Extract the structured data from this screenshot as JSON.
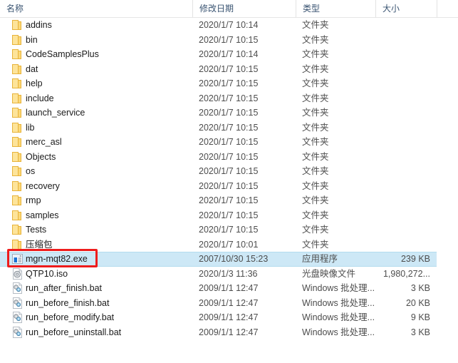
{
  "columns": [
    {
      "key": "name",
      "label": "名称"
    },
    {
      "key": "date",
      "label": "修改日期"
    },
    {
      "key": "type",
      "label": "类型"
    },
    {
      "key": "size",
      "label": "大小"
    }
  ],
  "header": {
    "name_label": "名称",
    "date_label": "修改日期",
    "type_label": "类型",
    "size_label": "大小"
  },
  "colors": {
    "selection_fill": "#cde8f6",
    "selection_border": "#b3dcee",
    "annotation": "#ee1c1c",
    "folder_icon": "#fde49a",
    "folder_icon_edge": "#e8b339",
    "header_text": "#3a5472",
    "row_text": "#1a1a1a",
    "meta_text": "#4d4d4d"
  },
  "annotation": {
    "shape": "rectangle",
    "target_row_index": 15,
    "target_label": "mgn-mqt82.exe"
  },
  "rows": [
    {
      "name": "addins",
      "date": "2020/1/7 10:14",
      "type": "文件夹",
      "size": "",
      "icon": "folder-icon",
      "selected": false
    },
    {
      "name": "bin",
      "date": "2020/1/7 10:15",
      "type": "文件夹",
      "size": "",
      "icon": "folder-icon",
      "selected": false
    },
    {
      "name": "CodeSamplesPlus",
      "date": "2020/1/7 10:14",
      "type": "文件夹",
      "size": "",
      "icon": "folder-icon",
      "selected": false
    },
    {
      "name": "dat",
      "date": "2020/1/7 10:15",
      "type": "文件夹",
      "size": "",
      "icon": "folder-icon",
      "selected": false
    },
    {
      "name": "help",
      "date": "2020/1/7 10:15",
      "type": "文件夹",
      "size": "",
      "icon": "folder-icon",
      "selected": false
    },
    {
      "name": "include",
      "date": "2020/1/7 10:15",
      "type": "文件夹",
      "size": "",
      "icon": "folder-icon",
      "selected": false
    },
    {
      "name": "launch_service",
      "date": "2020/1/7 10:15",
      "type": "文件夹",
      "size": "",
      "icon": "folder-icon",
      "selected": false
    },
    {
      "name": "lib",
      "date": "2020/1/7 10:15",
      "type": "文件夹",
      "size": "",
      "icon": "folder-icon",
      "selected": false
    },
    {
      "name": "merc_asl",
      "date": "2020/1/7 10:15",
      "type": "文件夹",
      "size": "",
      "icon": "folder-icon",
      "selected": false
    },
    {
      "name": "Objects",
      "date": "2020/1/7 10:15",
      "type": "文件夹",
      "size": "",
      "icon": "folder-icon",
      "selected": false
    },
    {
      "name": "os",
      "date": "2020/1/7 10:15",
      "type": "文件夹",
      "size": "",
      "icon": "folder-icon",
      "selected": false
    },
    {
      "name": "recovery",
      "date": "2020/1/7 10:15",
      "type": "文件夹",
      "size": "",
      "icon": "folder-icon",
      "selected": false
    },
    {
      "name": "rmp",
      "date": "2020/1/7 10:15",
      "type": "文件夹",
      "size": "",
      "icon": "folder-icon",
      "selected": false
    },
    {
      "name": "samples",
      "date": "2020/1/7 10:15",
      "type": "文件夹",
      "size": "",
      "icon": "folder-icon",
      "selected": false
    },
    {
      "name": "Tests",
      "date": "2020/1/7 10:15",
      "type": "文件夹",
      "size": "",
      "icon": "folder-icon",
      "selected": false
    },
    {
      "name": "压缩包",
      "date": "2020/1/7 10:01",
      "type": "文件夹",
      "size": "",
      "icon": "folder-icon",
      "selected": false
    },
    {
      "name": "mgn-mqt82.exe",
      "date": "2007/10/30 15:23",
      "type": "应用程序",
      "size": "239 KB",
      "icon": "application-icon",
      "selected": true
    },
    {
      "name": "QTP10.iso",
      "date": "2020/1/3 11:36",
      "type": "光盘映像文件",
      "size": "1,980,272...",
      "icon": "disc-image-icon",
      "selected": false
    },
    {
      "name": "run_after_finish.bat",
      "date": "2009/1/1 12:47",
      "type": "Windows 批处理...",
      "size": "3 KB",
      "icon": "batch-file-icon",
      "selected": false
    },
    {
      "name": "run_before_finish.bat",
      "date": "2009/1/1 12:47",
      "type": "Windows 批处理...",
      "size": "20 KB",
      "icon": "batch-file-icon",
      "selected": false
    },
    {
      "name": "run_before_modify.bat",
      "date": "2009/1/1 12:47",
      "type": "Windows 批处理...",
      "size": "9 KB",
      "icon": "batch-file-icon",
      "selected": false
    },
    {
      "name": "run_before_uninstall.bat",
      "date": "2009/1/1 12:47",
      "type": "Windows 批处理...",
      "size": "3 KB",
      "icon": "batch-file-icon",
      "selected": false
    }
  ]
}
